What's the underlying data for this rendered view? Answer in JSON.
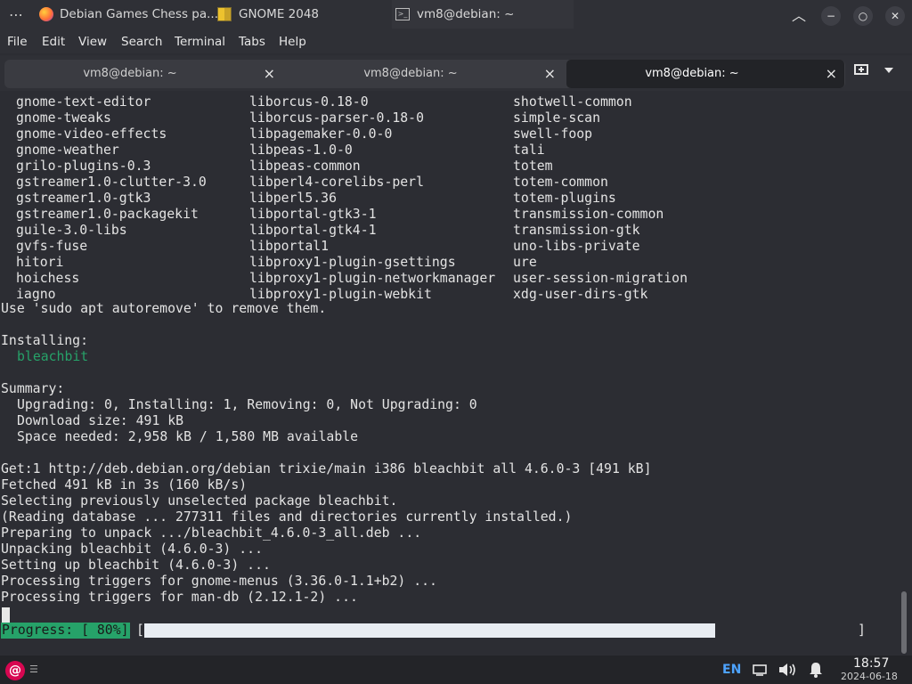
{
  "window": {
    "title": "vm8@debian: ~"
  },
  "titlebar_icons": {
    "menu": "⋯",
    "up": "︿",
    "minimize": "−",
    "restore": "○",
    "close": "✕"
  },
  "menu": [
    "File",
    "Edit",
    "View",
    "Search",
    "Terminal",
    "Tabs",
    "Help"
  ],
  "tabs": [
    {
      "label": "vm8@debian: ~",
      "active": false
    },
    {
      "label": "vm8@debian: ~",
      "active": false
    },
    {
      "label": "vm8@debian: ~",
      "active": true
    }
  ],
  "tab_close_glyph": "×",
  "packages": [
    [
      "gnome-text-editor",
      "liborcus-0.18-0",
      "shotwell-common"
    ],
    [
      "gnome-tweaks",
      "liborcus-parser-0.18-0",
      "simple-scan"
    ],
    [
      "gnome-video-effects",
      "libpagemaker-0.0-0",
      "swell-foop"
    ],
    [
      "gnome-weather",
      "libpeas-1.0-0",
      "tali"
    ],
    [
      "grilo-plugins-0.3",
      "libpeas-common",
      "totem"
    ],
    [
      "gstreamer1.0-clutter-3.0",
      "libperl4-corelibs-perl",
      "totem-common"
    ],
    [
      "gstreamer1.0-gtk3",
      "libperl5.36",
      "totem-plugins"
    ],
    [
      "gstreamer1.0-packagekit",
      "libportal-gtk3-1",
      "transmission-common"
    ],
    [
      "guile-3.0-libs",
      "libportal-gtk4-1",
      "transmission-gtk"
    ],
    [
      "gvfs-fuse",
      "libportal1",
      "uno-libs-private"
    ],
    [
      "hitori",
      "libproxy1-plugin-gsettings",
      "ure"
    ],
    [
      "hoichess",
      "libproxy1-plugin-networkmanager",
      "user-session-migration"
    ],
    [
      "iagno",
      "libproxy1-plugin-webkit",
      "xdg-user-dirs-gtk"
    ]
  ],
  "output": {
    "autoremove": "Use 'sudo apt autoremove' to remove them.",
    "installing_header": "Installing:",
    "installing_pkg": "bleachbit",
    "summary_header": "Summary:",
    "summary_lines": [
      "Upgrading: 0, Installing: 1, Removing: 0, Not Upgrading: 0",
      "Download size: 491 kB",
      "Space needed: 2,958 kB / 1,580 MB available"
    ],
    "log_lines": [
      "Get:1 http://deb.debian.org/debian trixie/main i386 bleachbit all 4.6.0-3 [491 kB]",
      "Fetched 491 kB in 3s (160 kB/s)",
      "Selecting previously unselected package bleachbit.",
      "(Reading database ... 277311 files and directories currently installed.)",
      "Preparing to unpack .../bleachbit_4.6.0-3_all.deb ...",
      "Unpacking bleachbit (4.6.0-3) ...",
      "Setting up bleachbit (4.6.0-3) ...",
      "Processing triggers for gnome-menus (3.36.0-1.1+b2) ...",
      "Processing triggers for man-db (2.12.1-2) ..."
    ],
    "progress_label": "Progress: [ 80%]",
    "progress_fraction": 0.8,
    "progress_open": "[",
    "progress_close": "]"
  },
  "taskbar": {
    "items": [
      {
        "label": "Debian Games Chess pa...",
        "icon": "firefox-icon"
      },
      {
        "label": "GNOME 2048",
        "icon": "gnome-2048-icon"
      },
      {
        "label": "vm8@debian: ~",
        "icon": "terminal-icon",
        "active": true
      }
    ],
    "language": "EN",
    "clock_time": "18:57",
    "clock_date": "2024-06-18"
  },
  "colors": {
    "accent_green": "#26a269",
    "terminal_bg": "#2c2d33"
  }
}
